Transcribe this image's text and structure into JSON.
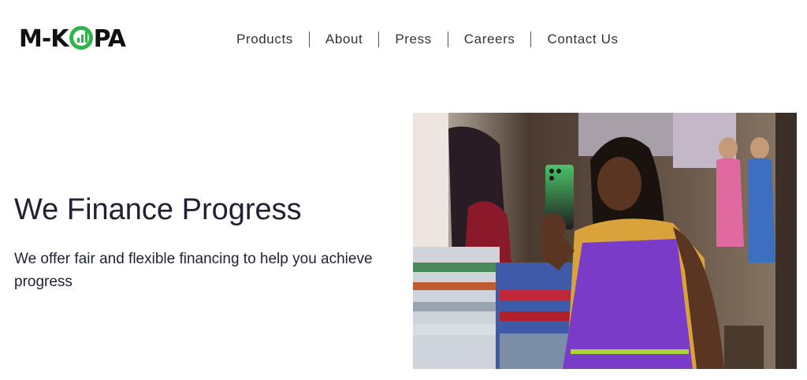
{
  "brand": {
    "logo_prefix": "M-K",
    "logo_suffix": "PA",
    "logo_accent": "#2fb34a"
  },
  "nav": {
    "items": [
      {
        "label": "Products"
      },
      {
        "label": "About"
      },
      {
        "label": "Press"
      },
      {
        "label": "Careers"
      },
      {
        "label": "Contact Us"
      }
    ]
  },
  "hero": {
    "title": "We Finance Progress",
    "subtitle": "We offer fair and flexible financing to help you achieve progress",
    "image_alt": "Market vendor in a purple apron holding up a green smartphone"
  }
}
